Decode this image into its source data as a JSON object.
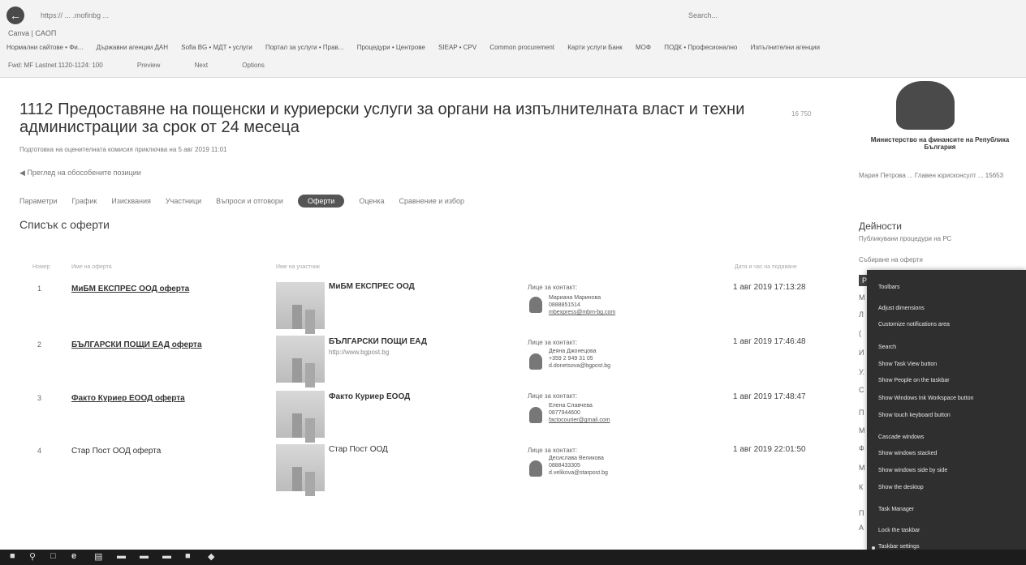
{
  "browser": {
    "address": "https:// ... .mofinbg ...",
    "search": "Search...",
    "tabs_row": "Canva | CAOП",
    "favorites": [
      "Нормални сайтове • Фи...",
      "Държавни агенции ДАН",
      "Sofia BG • МДТ • услуги",
      "Портал за услуги • Прав...",
      "Процедури • Центрове",
      "SIEAP • CPV",
      "Common procurement",
      "Карти услуги Банк",
      "MOФ",
      "ПОДК • Професионално",
      "Изпълнителни агенции"
    ],
    "page_bar": [
      "Fwd: MF Lastnet 1120-1124: 100",
      "Preview",
      "Next",
      "Options"
    ]
  },
  "page": {
    "title": "1112 Предоставяне на пощенски и куриерски услуги за органи на изпълнителната власт и техни администрации за срок от 24 месеца",
    "views": "16 750",
    "meta": "Подготовка на оценителната комисия   приключва на 5 авг 2019 11:01",
    "share": "Преглед на обособените позиции",
    "tabs": [
      "Параметри",
      "График",
      "Изисквания",
      "Участници",
      "Въпроси и отговори",
      "Оферти",
      "Оценка",
      "Сравнение и избор"
    ],
    "section": "Списък с оферти",
    "columns": [
      "Номер",
      "Име на оферта",
      "Име на участник",
      "Дата и час на подаване"
    ]
  },
  "offers": [
    {
      "num": "1",
      "name": "МиБМ ЕКСПРЕС ООД оферта",
      "participant": "МиБМ ЕКСПРЕС ООД",
      "url": "",
      "contact_label": "Лице за контакт:",
      "contact": [
        "Мариана Маринова",
        "0888851514",
        "mbexpress@mbm-bg.com"
      ],
      "date": "1 авг 2019 17:13:28"
    },
    {
      "num": "2",
      "name": "БЪЛГАРСКИ ПОЩИ ЕАД оферта",
      "participant": "БЪЛГАРСКИ ПОЩИ ЕАД",
      "url": "http://www.bgpost.bg",
      "contact_label": "Лице за контакт:",
      "contact": [
        "Деяна Джонецова",
        "+359 2 949 31 05",
        "d.donetsova@bgpost.bg"
      ],
      "date": "1 авг 2019 17:46:48"
    },
    {
      "num": "3",
      "name": "Факто Куриер ЕООД оферта",
      "participant": "Факто Куриер ЕООД",
      "url": "",
      "contact_label": "Лице за контакт:",
      "contact": [
        "Елена Славчева",
        "0877944600",
        "factocourier@gmail.com"
      ],
      "date": "1 авг 2019 17:48:47"
    },
    {
      "num": "4",
      "name": "Стар Пост ООД оферта",
      "participant": "Стар Пост ООД",
      "url": "",
      "contact_label": "Лице за контакт:",
      "contact": [
        "Десислава Великова",
        "0888433305",
        "d.velikova@starpost.bg"
      ],
      "date": "1 авг 2019 22:01:50"
    }
  ],
  "sidebar": {
    "ministry": "Министерство на финансите на Република България",
    "contact": "Мария Петрова ... Главен юрисконсулт ... 15653",
    "head": "Дейности",
    "sub1": "Публикувани процедури на РС",
    "sub2": "Събиране на оферти",
    "arrow_label": "Ре",
    "letters": [
      "М",
      "Л",
      "(",
      "И",
      "У.",
      "С",
      "П",
      "М",
      "Ф",
      "М",
      "К",
      "П",
      "А"
    ]
  },
  "context_menu": {
    "items": [
      "Toolbars",
      "Adjust dimensions",
      "Customize notifications area",
      "Search",
      "Show Task View button",
      "Show People on the taskbar",
      "Show Windows Ink Workspace button",
      "Show touch keyboard button",
      "Cascade windows",
      "Show windows stacked",
      "Show windows side by side",
      "Show the desktop",
      "Task Manager",
      "Lock the taskbar",
      "Taskbar settings"
    ]
  },
  "taskbar": {
    "icons": [
      "start-icon",
      "search-icon",
      "taskview-icon",
      "edge-icon",
      "explorer-icon"
    ]
  }
}
